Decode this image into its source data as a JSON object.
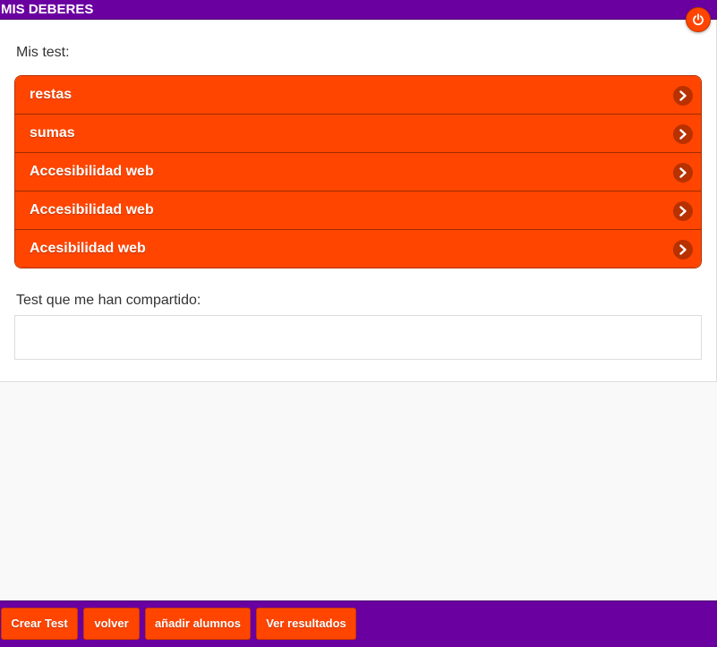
{
  "header": {
    "title": "MIS DEBERES",
    "power_icon": "power-icon"
  },
  "main": {
    "my_tests_label": "Mis test:",
    "tests": [
      {
        "label": "restas"
      },
      {
        "label": "sumas"
      },
      {
        "label": "Accesibilidad web"
      },
      {
        "label": "Accesibilidad web"
      },
      {
        "label": "Acesibilidad web"
      }
    ],
    "shared_label": "Test que me han compartido:",
    "shared_tests": []
  },
  "footer": {
    "crear_test": "Crear Test",
    "volver": "volver",
    "anadir_alumnos": "añadir alumnos",
    "ver_resultados": "Ver resultados"
  },
  "colors": {
    "header_bg": "#6a00a0",
    "accent": "#ff4500",
    "page_bg": "#f9f9f9"
  }
}
